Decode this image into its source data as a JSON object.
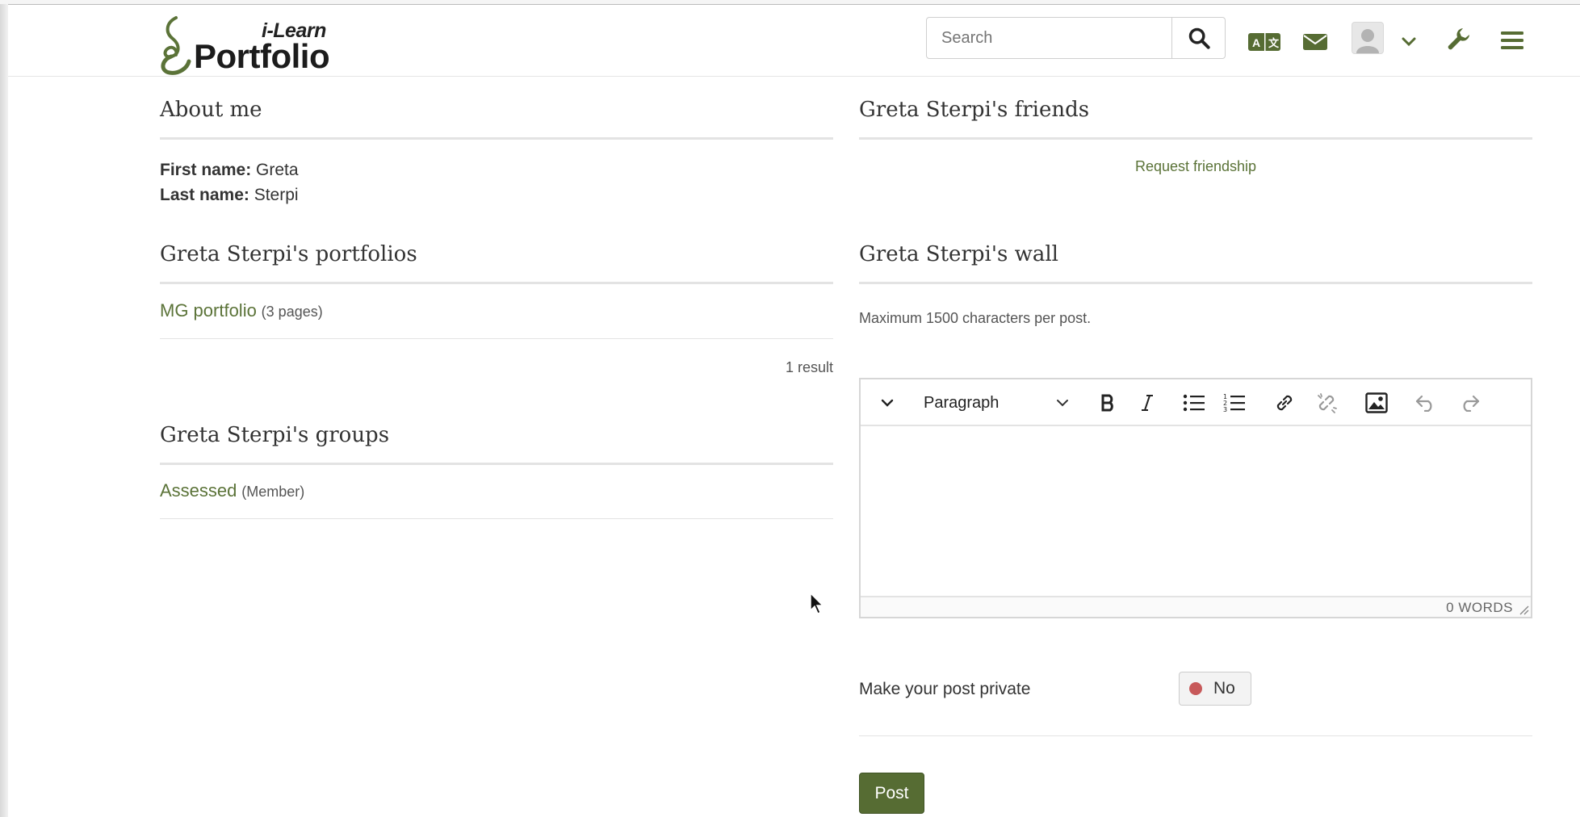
{
  "header": {
    "logo_top": "i-Learn",
    "logo_main": "Portfolio",
    "search_placeholder": "Search",
    "brand_color": "#566c33",
    "icons": [
      "search-icon",
      "language-icon",
      "mail-icon",
      "avatar",
      "chevron-down-icon",
      "wrench-icon",
      "hamburger-menu-icon"
    ]
  },
  "about": {
    "title": "About me",
    "first_name_label": "First name:",
    "first_name": "Greta",
    "last_name_label": "Last name:",
    "last_name": "Sterpi"
  },
  "portfolios": {
    "title": "Greta Sterpi's portfolios",
    "items": [
      {
        "name": "MG portfolio",
        "meta": "(3 pages)"
      }
    ],
    "result_count": "1 result"
  },
  "groups": {
    "title": "Greta Sterpi's groups",
    "items": [
      {
        "name": "Assessed",
        "meta": "(Member)"
      }
    ]
  },
  "friends": {
    "title": "Greta Sterpi's friends",
    "request_link": "Request friendship"
  },
  "wall": {
    "title": "Greta Sterpi's wall",
    "hint": "Maximum 1500 characters per post.",
    "editor": {
      "block_format": "Paragraph",
      "word_count": "0 WORDS",
      "toolbar_icons": [
        "chevron-down-icon",
        "bold-icon",
        "italic-icon",
        "bullet-list-icon",
        "numbered-list-icon",
        "link-icon",
        "unlink-icon",
        "image-icon",
        "undo-icon",
        "redo-icon"
      ]
    },
    "private_label": "Make your post private",
    "private_value": "No",
    "post_button": "Post"
  }
}
